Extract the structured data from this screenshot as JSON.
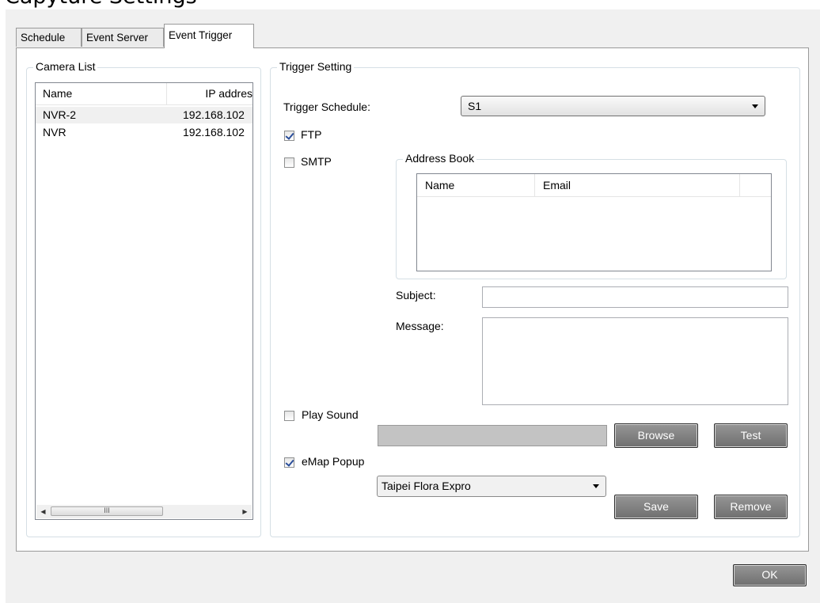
{
  "window": {
    "title": "Capyture Settings"
  },
  "tabs": [
    {
      "label": "Schedule"
    },
    {
      "label": "Event Server"
    },
    {
      "label": "Event Trigger"
    }
  ],
  "camera_list": {
    "group_label": "Camera List",
    "columns": [
      "Name",
      "IP addres"
    ],
    "rows": [
      {
        "name": "NVR-2",
        "ip": "192.168.102"
      },
      {
        "name": "NVR",
        "ip": "192.168.102"
      }
    ],
    "scroll_thumb_glyph": "III"
  },
  "trigger_setting": {
    "group_label": "Trigger Setting",
    "schedule_label": "Trigger Schedule:",
    "schedule_value": "S1",
    "ftp": {
      "label": "FTP",
      "checked": true
    },
    "smtp": {
      "label": "SMTP",
      "checked": false
    },
    "address_book": {
      "group_label": "Address Book",
      "columns": [
        "Name",
        "Email"
      ]
    },
    "subject_label": "Subject:",
    "message_label": "Message:",
    "play_sound": {
      "label": "Play Sound",
      "checked": false
    },
    "browse_label": "Browse",
    "test_label": "Test",
    "emap_popup": {
      "label": "eMap Popup",
      "checked": true
    },
    "emap_value": "Taipei Flora Expro",
    "save_label": "Save",
    "remove_label": "Remove"
  },
  "footer": {
    "ok_label": "OK"
  }
}
